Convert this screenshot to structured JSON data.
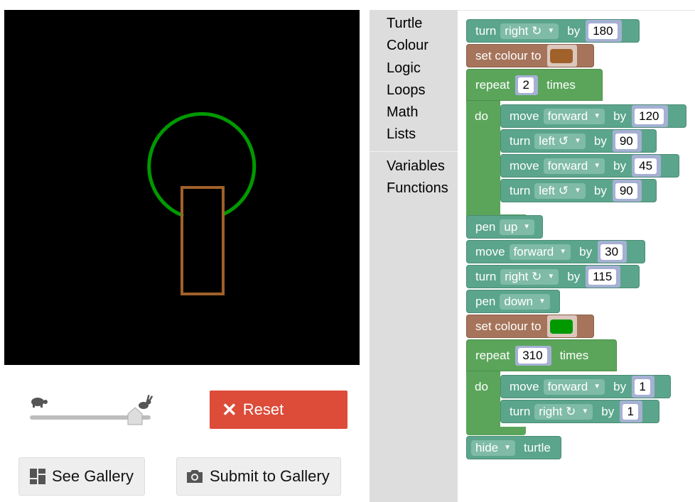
{
  "canvas": {
    "background": "#000000",
    "drawing": {
      "circle_color": "#009900",
      "trunk_color": "#a0612a"
    }
  },
  "controls": {
    "reset_label": "Reset",
    "gallery_label": "See Gallery",
    "submit_label": "Submit to Gallery",
    "reset_color": "#dd4b39"
  },
  "toolbox": {
    "items": [
      "Turtle",
      "Colour",
      "Logic",
      "Loops",
      "Math",
      "Lists"
    ],
    "items2": [
      "Variables",
      "Functions"
    ]
  },
  "blocks": {
    "b1": {
      "kw": "turn",
      "dd": "right ↻",
      "by": "by",
      "num": "180"
    },
    "b2": {
      "kw": "set colour to",
      "color": "#a0612a"
    },
    "b3": {
      "kw": "repeat",
      "num": "2",
      "tail": "times",
      "do": "do"
    },
    "b4": {
      "kw": "move",
      "dd": "forward",
      "by": "by",
      "num": "120"
    },
    "b5": {
      "kw": "turn",
      "dd": "left ↺",
      "by": "by",
      "num": "90"
    },
    "b6": {
      "kw": "move",
      "dd": "forward",
      "by": "by",
      "num": "45"
    },
    "b7": {
      "kw": "turn",
      "dd": "left ↺",
      "by": "by",
      "num": "90"
    },
    "b8": {
      "kw": "pen",
      "dd": "up"
    },
    "b9": {
      "kw": "move",
      "dd": "forward",
      "by": "by",
      "num": "30"
    },
    "b10": {
      "kw": "turn",
      "dd": "right ↻",
      "by": "by",
      "num": "115"
    },
    "b11": {
      "kw": "pen",
      "dd": "down"
    },
    "b12": {
      "kw": "set colour to",
      "color": "#009900"
    },
    "b13": {
      "kw": "repeat",
      "num": "310",
      "tail": "times",
      "do": "do"
    },
    "b14": {
      "kw": "move",
      "dd": "forward",
      "by": "by",
      "num": "1"
    },
    "b15": {
      "kw": "turn",
      "dd": "right ↻",
      "by": "by",
      "num": "1"
    },
    "b16": {
      "dd": "hide",
      "kw": "turtle"
    }
  }
}
